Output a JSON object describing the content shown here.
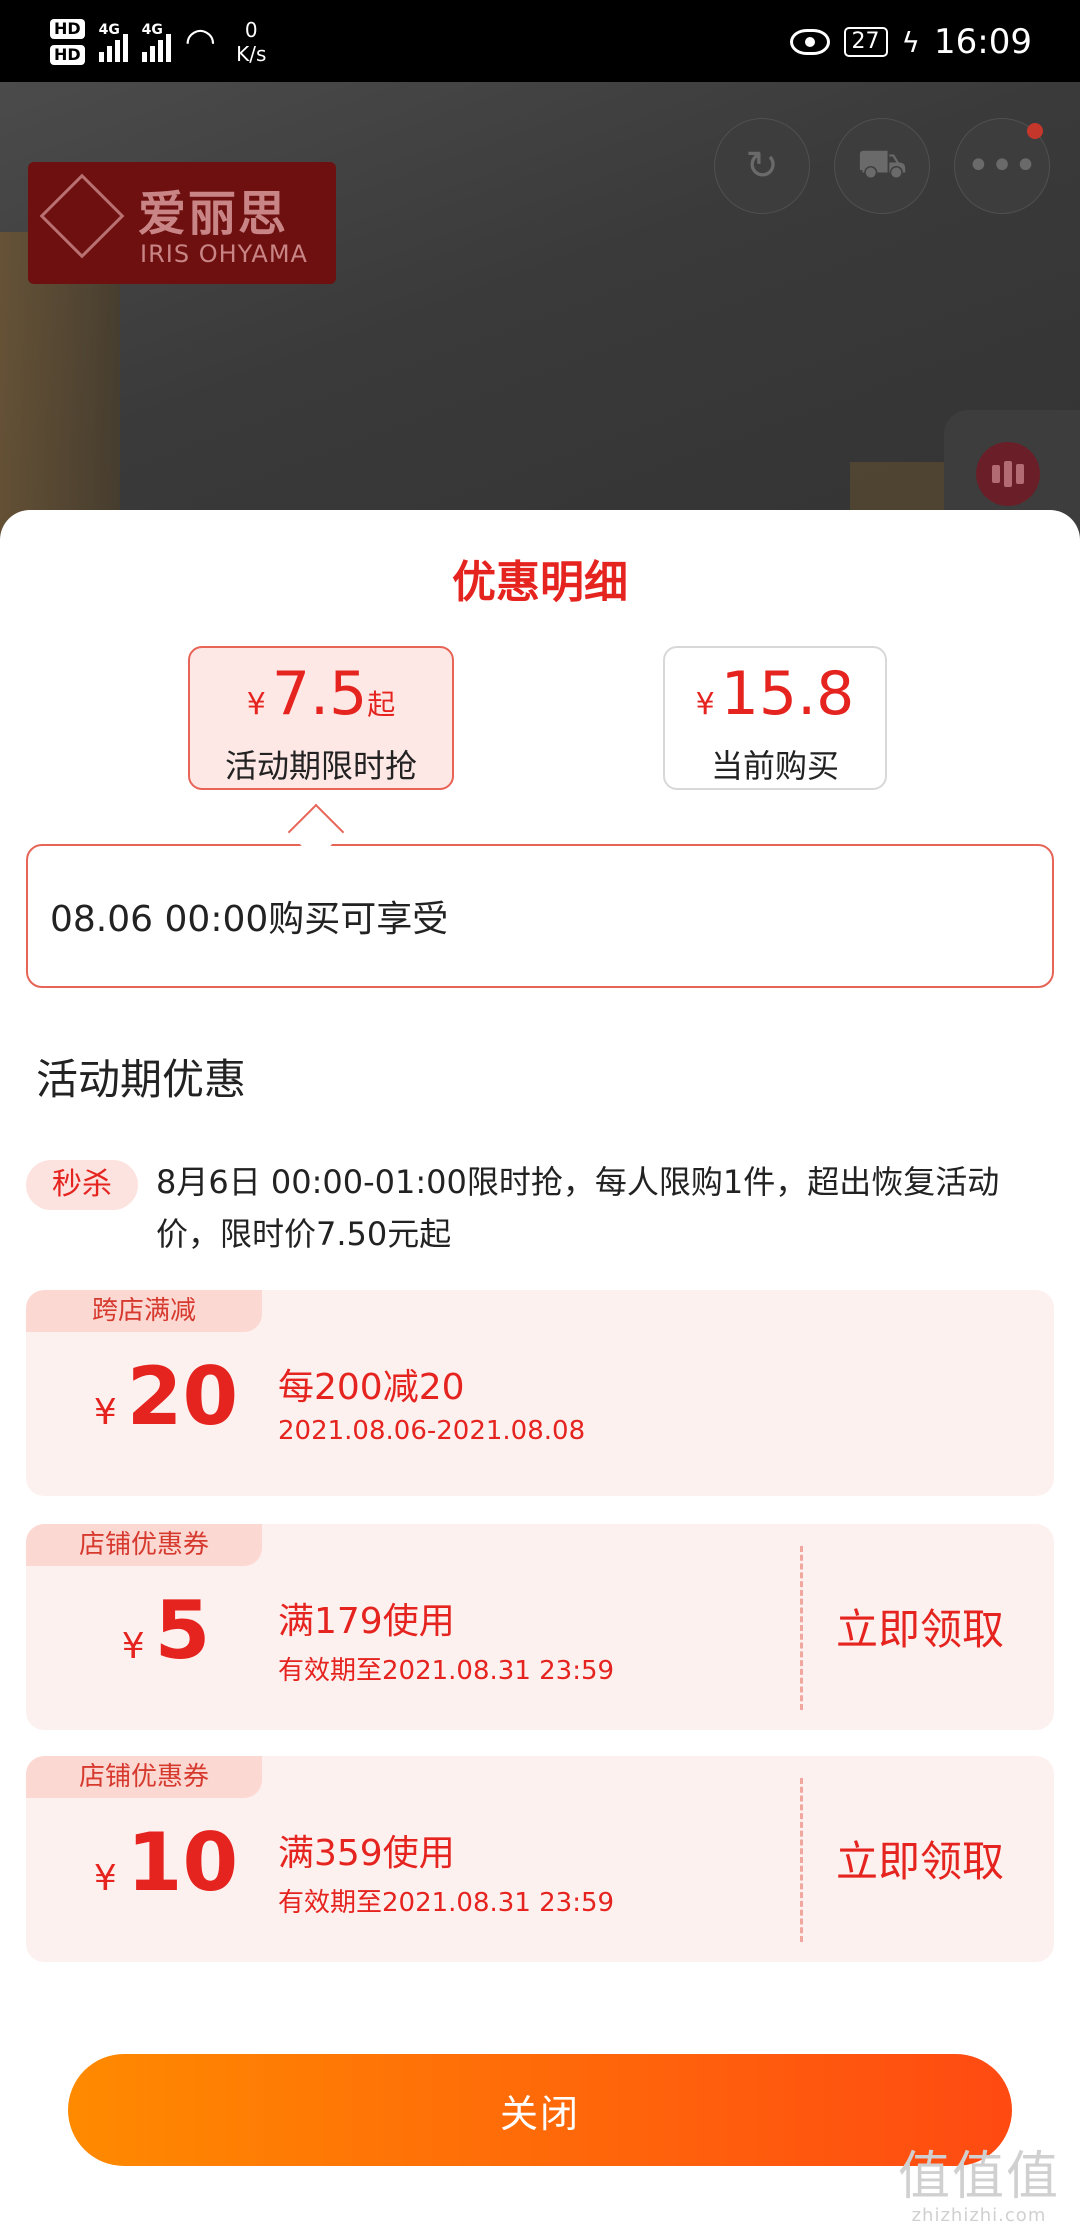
{
  "status_bar": {
    "hd1": "HD",
    "hd2": "HD",
    "net1": "4G",
    "net2": "4G",
    "speed_value": "0",
    "speed_unit": "K/s",
    "battery": "27",
    "time": "16:09"
  },
  "background": {
    "brand_cn": "爱丽思",
    "brand_en": "IRIS OHYAMA"
  },
  "sheet": {
    "title": "优惠明细",
    "tabs": [
      {
        "currency": "¥",
        "price": "7.5",
        "suffix": "起",
        "label": "活动期限时抢"
      },
      {
        "currency": "¥",
        "price": "15.8",
        "suffix": "",
        "label": "当前购买"
      }
    ],
    "info_text": "08.06 00:00购买可享受",
    "section_title": "活动期优惠",
    "flash_sale": {
      "tag": "秒杀",
      "text": "8月6日 00:00-01:00限时抢，每人限购1件，超出恢复活动价，限时价7.50元起"
    },
    "cards": [
      {
        "tag": "跨店满减",
        "currency": "¥",
        "amount": "20",
        "main": "每200减20",
        "sub": "2021.08.06-2021.08.08",
        "action": ""
      },
      {
        "tag": "店铺优惠券",
        "currency": "¥",
        "amount": "5",
        "main": "满179使用",
        "sub": "有效期至2021.08.31 23:59",
        "action": "立即领取"
      },
      {
        "tag": "店铺优惠券",
        "currency": "¥",
        "amount": "10",
        "main": "满359使用",
        "sub": "有效期至2021.08.31 23:59",
        "action": "立即领取"
      }
    ],
    "close_label": "关闭"
  },
  "watermark": {
    "big": "值值值",
    "small": "zhizhizhi.com"
  },
  "colors": {
    "accent_red": "#e5231f",
    "button_gradient_start": "#ff8a00",
    "button_gradient_end": "#ff4a12",
    "card_bg": "#fdf1ef"
  }
}
